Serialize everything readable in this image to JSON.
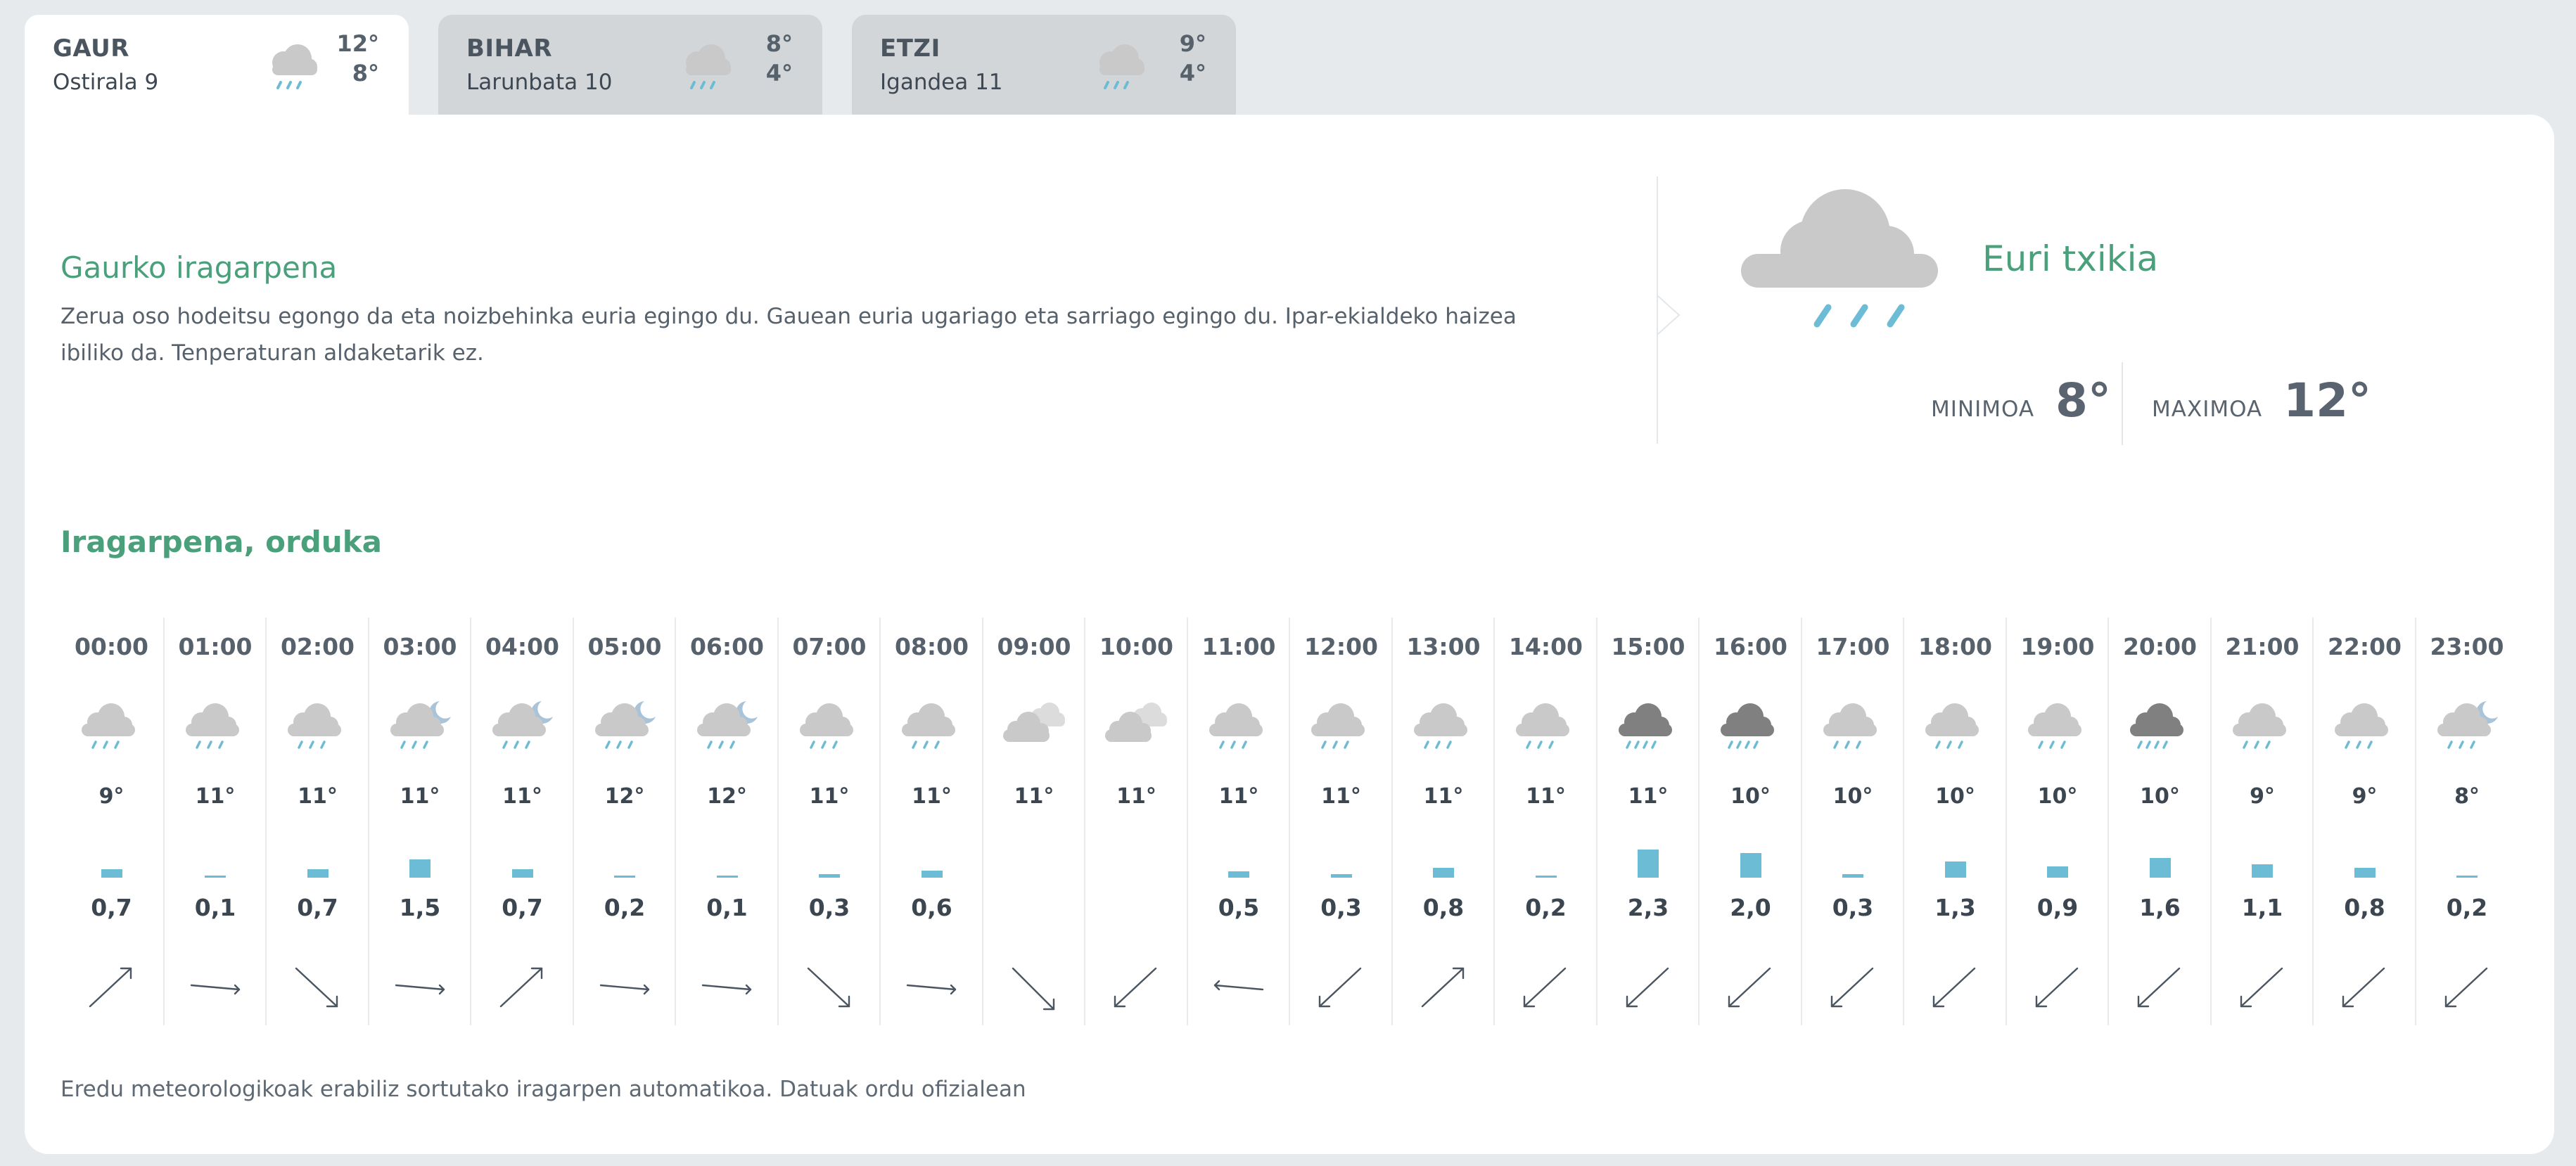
{
  "tabs": [
    {
      "label": "GAUR",
      "date": "Ostirala 9",
      "max": "12°",
      "min": "8°",
      "icon": "cloud-rain-icon",
      "active": true
    },
    {
      "label": "BIHAR",
      "date": "Larunbata 10",
      "max": "8°",
      "min": "4°",
      "icon": "cloud-rain-icon",
      "active": false
    },
    {
      "label": "ETZI",
      "date": "Igandea 11",
      "max": "9°",
      "min": "4°",
      "icon": "cloud-rain-icon",
      "active": false
    }
  ],
  "summary": {
    "title": "Gaurko iragarpena",
    "text": "Zerua oso hodeitsu egongo da eta noizbehinka euria egingo du. Gauean euria ugariago eta sarriago egingo du. Ipar-ekialdeko haizea ibiliko da. Tenperaturan aldaketarik ez."
  },
  "today": {
    "condition": "Euri txikia",
    "min_label": "MINIMOA",
    "min_value": "8°",
    "max_label": "MAXIMOA",
    "max_value": "12°",
    "icon": "cloud-rain-icon"
  },
  "hourly_title": "Iragarpena, orduka",
  "hours": [
    {
      "time": "00:00",
      "icon": "cloud-rain",
      "temp": "9°",
      "precip": "0,7",
      "wind": "ne"
    },
    {
      "time": "01:00",
      "icon": "cloud-rain",
      "temp": "11°",
      "precip": "0,1",
      "wind": "e"
    },
    {
      "time": "02:00",
      "icon": "cloud-rain",
      "temp": "11°",
      "precip": "0,7",
      "wind": "se"
    },
    {
      "time": "03:00",
      "icon": "moon-cloud-rain",
      "temp": "11°",
      "precip": "1,5",
      "wind": "e"
    },
    {
      "time": "04:00",
      "icon": "moon-cloud-rain",
      "temp": "11°",
      "precip": "0,7",
      "wind": "ne"
    },
    {
      "time": "05:00",
      "icon": "moon-cloud-rain",
      "temp": "12°",
      "precip": "0,2",
      "wind": "e"
    },
    {
      "time": "06:00",
      "icon": "moon-cloud-rain",
      "temp": "12°",
      "precip": "0,1",
      "wind": "e"
    },
    {
      "time": "07:00",
      "icon": "cloud-rain",
      "temp": "11°",
      "precip": "0,3",
      "wind": "se"
    },
    {
      "time": "08:00",
      "icon": "cloud-rain",
      "temp": "11°",
      "precip": "0,6",
      "wind": "e"
    },
    {
      "time": "09:00",
      "icon": "cloudy",
      "temp": "11°",
      "precip": "",
      "wind": "nw-se"
    },
    {
      "time": "10:00",
      "icon": "cloudy",
      "temp": "11°",
      "precip": "",
      "wind": "sw"
    },
    {
      "time": "11:00",
      "icon": "cloud-rain",
      "temp": "11°",
      "precip": "0,5",
      "wind": "w"
    },
    {
      "time": "12:00",
      "icon": "cloud-rain",
      "temp": "11°",
      "precip": "0,3",
      "wind": "sw"
    },
    {
      "time": "13:00",
      "icon": "cloud-rain",
      "temp": "11°",
      "precip": "0,8",
      "wind": "ne"
    },
    {
      "time": "14:00",
      "icon": "cloud-rain",
      "temp": "11°",
      "precip": "0,2",
      "wind": "sw"
    },
    {
      "time": "15:00",
      "icon": "cloud-heavy-rain",
      "temp": "11°",
      "precip": "2,3",
      "wind": "sw"
    },
    {
      "time": "16:00",
      "icon": "cloud-heavy-rain",
      "temp": "10°",
      "precip": "2,0",
      "wind": "sw"
    },
    {
      "time": "17:00",
      "icon": "cloud-rain",
      "temp": "10°",
      "precip": "0,3",
      "wind": "sw"
    },
    {
      "time": "18:00",
      "icon": "cloud-rain",
      "temp": "10°",
      "precip": "1,3",
      "wind": "sw"
    },
    {
      "time": "19:00",
      "icon": "cloud-rain",
      "temp": "10°",
      "precip": "0,9",
      "wind": "sw"
    },
    {
      "time": "20:00",
      "icon": "cloud-heavy-rain",
      "temp": "10°",
      "precip": "1,6",
      "wind": "sw"
    },
    {
      "time": "21:00",
      "icon": "cloud-rain",
      "temp": "9°",
      "precip": "1,1",
      "wind": "sw"
    },
    {
      "time": "22:00",
      "icon": "cloud-rain",
      "temp": "9°",
      "precip": "0,8",
      "wind": "sw"
    },
    {
      "time": "23:00",
      "icon": "moon-cloud-rain",
      "temp": "8°",
      "precip": "0,2",
      "wind": "sw"
    }
  ],
  "footer": "Eredu meteorologikoak erabiliz sortutako iragarpen automatikoa. Datuak ordu ofizialean",
  "colors": {
    "accent": "#4aa07a",
    "rain": "#6dbcd6",
    "cloud": "#c9c9c9",
    "cloud_dark": "#808080",
    "moon": "#a9c4d9",
    "page_bg": "#e6eaed"
  }
}
